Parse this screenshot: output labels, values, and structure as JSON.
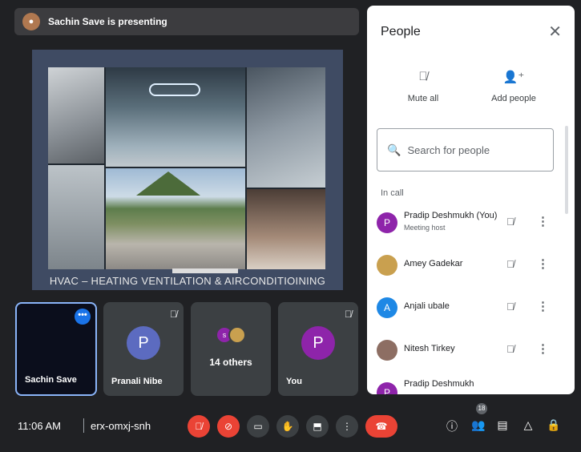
{
  "presenter": {
    "text": "Sachin Save is presenting"
  },
  "slide": {
    "caption": "HVAC – HEATING VENTILATION & AIRCONDITIOINING"
  },
  "tiles": [
    {
      "name": "Sachin Save"
    },
    {
      "name": "Pranali Nibe",
      "initial": "P"
    },
    {
      "name": "14 others",
      "mini_initial": "s"
    },
    {
      "name": "You",
      "initial": "P"
    }
  ],
  "panel": {
    "title": "People",
    "mute_all": "Mute all",
    "add_people": "Add people",
    "search_placeholder": "Search for people",
    "in_call": "In call",
    "people": [
      {
        "name": "Pradip Deshmukh (You)",
        "role": "Meeting host",
        "initial": "P",
        "color": "#8e24aa"
      },
      {
        "name": "Amey Gadekar",
        "initial": "",
        "color": "#c9a04f"
      },
      {
        "name": "Anjali ubale",
        "initial": "A",
        "color": "#1e88e5"
      },
      {
        "name": "Nitesh Tirkey",
        "initial": "",
        "color": "#8d6e63"
      },
      {
        "name": "Pradip Deshmukh",
        "initial": "P",
        "color": "#8e24aa"
      }
    ]
  },
  "bottom": {
    "time": "11:06 AM",
    "meeting_code": "erx-omxj-snh",
    "people_count": "18"
  },
  "colors": {
    "accent_blue": "#1a73e8",
    "end_red": "#ea4335",
    "purple": "#8e24aa"
  }
}
